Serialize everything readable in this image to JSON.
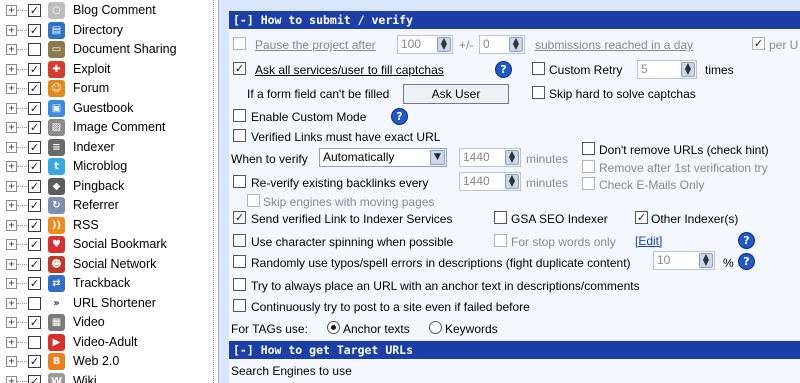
{
  "tree": {
    "items": [
      {
        "label": "Blog Comment",
        "expander": "+",
        "checked": true,
        "icon": "bubble-icon",
        "glyph": "○",
        "color": "#bdbdbd"
      },
      {
        "label": "Directory",
        "expander": "+",
        "checked": true,
        "icon": "folder-icon",
        "glyph": "▤",
        "color": "#2f74c9"
      },
      {
        "label": "Document Sharing",
        "expander": "+",
        "checked": false,
        "icon": "document-folder-icon",
        "glyph": "▭",
        "color": "#8d7a4a"
      },
      {
        "label": "Exploit",
        "expander": "+",
        "checked": true,
        "icon": "exploit-icon",
        "glyph": "✚",
        "color": "#d63b2b"
      },
      {
        "label": "Forum",
        "expander": "+",
        "checked": true,
        "icon": "forum-people-icon",
        "glyph": "☺",
        "color": "#e08a1e"
      },
      {
        "label": "Guestbook",
        "expander": "+",
        "checked": true,
        "icon": "guestbook-icon",
        "glyph": "▣",
        "color": "#3b8be0"
      },
      {
        "label": "Image Comment",
        "expander": "+",
        "checked": true,
        "icon": "image-icon",
        "glyph": "▨",
        "color": "#8a8a8a"
      },
      {
        "label": "Indexer",
        "expander": "+",
        "checked": true,
        "icon": "indexer-icon",
        "glyph": "≡",
        "color": "#6a6a6a"
      },
      {
        "label": "Microblog",
        "expander": "+",
        "checked": true,
        "icon": "twitter-bird-icon",
        "glyph": "t",
        "color": "#37a7e8"
      },
      {
        "label": "Pingback",
        "expander": "+",
        "checked": true,
        "icon": "pingback-icon",
        "glyph": "◆",
        "color": "#5c5c5c"
      },
      {
        "label": "Referrer",
        "expander": "+",
        "checked": true,
        "icon": "referrer-icon",
        "glyph": "↻",
        "color": "#7f8fb0"
      },
      {
        "label": "RSS",
        "expander": "+",
        "checked": true,
        "icon": "rss-icon",
        "glyph": "))",
        "color": "#f08a1c"
      },
      {
        "label": "Social Bookmark",
        "expander": "+",
        "checked": true,
        "icon": "heart-icon",
        "glyph": "♥",
        "color": "#d8312c"
      },
      {
        "label": "Social Network",
        "expander": "+",
        "checked": true,
        "icon": "people-icon",
        "glyph": "☻",
        "color": "#c0392b"
      },
      {
        "label": "Trackback",
        "expander": "+",
        "checked": true,
        "icon": "trackback-icon",
        "glyph": "⇄",
        "color": "#2f6fc9"
      },
      {
        "label": "URL Shortener",
        "expander": "+",
        "checked": false,
        "icon": "chevrons-icon",
        "glyph": "»",
        "color": "#ffffff"
      },
      {
        "label": "Video",
        "expander": "+",
        "checked": true,
        "icon": "film-icon",
        "glyph": "▦",
        "color": "#7a7a7a"
      },
      {
        "label": "Video-Adult",
        "expander": "+",
        "checked": false,
        "icon": "play-icon",
        "glyph": "▶",
        "color": "#d8312c"
      },
      {
        "label": "Web 2.0",
        "expander": "+",
        "checked": true,
        "icon": "blogger-icon",
        "glyph": "B",
        "color": "#f07d1c"
      },
      {
        "label": "Wiki",
        "expander": "+",
        "checked": true,
        "icon": "wiki-icon",
        "glyph": "W",
        "color": "#9a9a9a"
      }
    ]
  },
  "submit": {
    "header": "[-] How to submit / verify",
    "pause_label": "Pause the project after",
    "pause_count": "100",
    "plus_minus": "+/-",
    "pause_variance": "0",
    "pause_suffix": "submissions reached in a day",
    "per_url_label": "per U",
    "ask_all_label": "Ask all services/user to fill captchas",
    "custom_retry_label": "Custom Retry",
    "retry_value": "5",
    "times_label": "times",
    "form_field_label": "If a form field can't be filled",
    "ask_user_button": "Ask User",
    "skip_hard_label": "Skip hard to solve captchas",
    "custom_mode_label": "Enable Custom Mode",
    "exact_url_label": "Verified Links must have exact URL",
    "dont_remove_label": "Don't remove URLs (check hint)",
    "when_verify_label": "When to verify",
    "when_verify_value": "Automatically",
    "verify_minutes": "1440",
    "minutes_label": "minutes",
    "remove_after_label": "Remove after 1st verification try",
    "reverify_label": "Re-verify existing backlinks every",
    "reverify_minutes": "1440",
    "reverify_minutes_label": "minutes",
    "check_emails_label": "Check E-Mails Only",
    "skip_moving_label": "Skip engines with moving pages",
    "send_indexer_label": "Send verified Link to Indexer Services",
    "gsa_indexer_label": "GSA SEO Indexer",
    "other_indexer_label": "Other Indexer(s)",
    "char_spinning_label": "Use character spinning when possible",
    "stop_words_label": "For stop words only",
    "edit_link": "[Edit]",
    "typos_label": "Randomly use typos/spell errors in descriptions (fight duplicate content)",
    "typos_value": "10",
    "percent_label": "%",
    "anchor_url_label": "Try to always place an URL with an anchor text in descriptions/comments",
    "continuously_label": "Continuously try to post to a site even if failed before",
    "tags_label": "For TAGs use:",
    "anchor_texts_label": "Anchor texts",
    "keywords_label": "Keywords"
  },
  "target": {
    "header": "[-] How to get Target URLs",
    "search_engines_label": "Search Engines to use"
  },
  "colors": {
    "section_header": "#1b3fa6",
    "panel_bg": "#d9e6fb",
    "help_icon": "#1f58c7"
  }
}
